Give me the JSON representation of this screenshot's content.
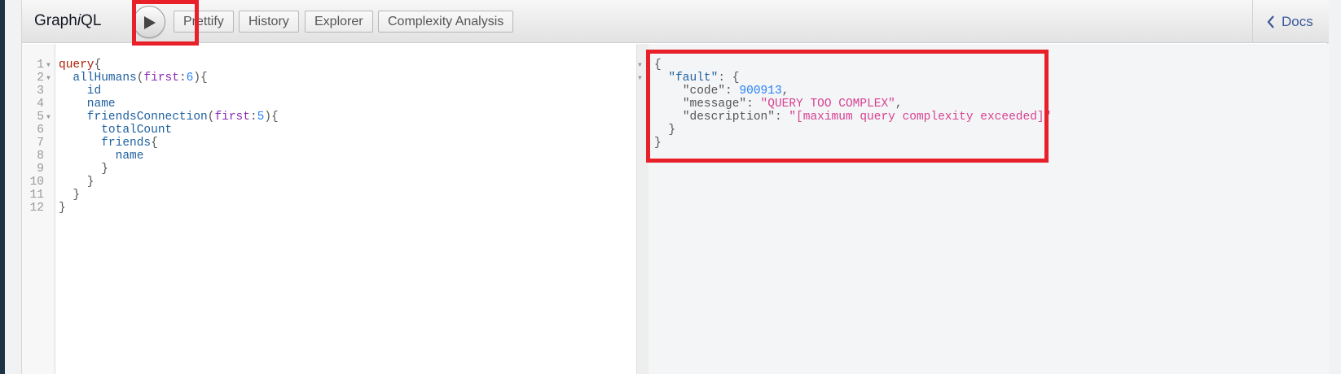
{
  "app": {
    "title_prefix": "Graph",
    "title_italic": "i",
    "title_suffix": "QL"
  },
  "toolbar": {
    "run_label": "Execute query",
    "buttons": [
      "Prettify",
      "History",
      "Explorer",
      "Complexity Analysis"
    ],
    "docs_label": "Docs"
  },
  "query_editor": {
    "line_numbers": [
      "1",
      "2",
      "3",
      "4",
      "5",
      "6",
      "7",
      "8",
      "9",
      "10",
      "11",
      "12"
    ],
    "lines": [
      [
        [
          "kw",
          "query"
        ],
        [
          "pun",
          "{"
        ]
      ],
      [
        [
          "def",
          "  allHumans"
        ],
        [
          "pun",
          "("
        ],
        [
          "attr",
          "first"
        ],
        [
          "pun",
          ":"
        ],
        [
          "num",
          "6"
        ],
        [
          "pun",
          "){"
        ]
      ],
      [
        [
          "def",
          "    id"
        ]
      ],
      [
        [
          "def",
          "    name"
        ]
      ],
      [
        [
          "def",
          "    friendsConnection"
        ],
        [
          "pun",
          "("
        ],
        [
          "attr",
          "first"
        ],
        [
          "pun",
          ":"
        ],
        [
          "num",
          "5"
        ],
        [
          "pun",
          "){"
        ]
      ],
      [
        [
          "def",
          "      totalCount"
        ]
      ],
      [
        [
          "def",
          "      friends"
        ],
        [
          "pun",
          "{"
        ]
      ],
      [
        [
          "def",
          "        name"
        ]
      ],
      [
        [
          "pun",
          "      }"
        ]
      ],
      [
        [
          "pun",
          "    }"
        ]
      ],
      [
        [
          "pun",
          "  }"
        ]
      ],
      [
        [
          "pun",
          "}"
        ]
      ]
    ]
  },
  "response": {
    "lines": [
      [
        [
          "pun",
          "{"
        ]
      ],
      [
        [
          "pun",
          "  "
        ],
        [
          "prop",
          "\"fault\""
        ],
        [
          "pun",
          ": {"
        ]
      ],
      [
        [
          "pun",
          "    "
        ],
        [
          "pun",
          "\"code\""
        ],
        [
          "pun",
          ": "
        ],
        [
          "num",
          "900913"
        ],
        [
          "pun",
          ","
        ]
      ],
      [
        [
          "pun",
          "    "
        ],
        [
          "pun",
          "\"message\""
        ],
        [
          "pun",
          ": "
        ],
        [
          "str",
          "\"QUERY TOO COMPLEX\""
        ],
        [
          "pun",
          ","
        ]
      ],
      [
        [
          "pun",
          "    "
        ],
        [
          "pun",
          "\"description\""
        ],
        [
          "pun",
          ": "
        ],
        [
          "str",
          "\"[maximum query complexity exceeded]\""
        ]
      ],
      [
        [
          "pun",
          "  }"
        ]
      ],
      [
        [
          "pun",
          "}"
        ]
      ]
    ]
  },
  "colors": {
    "highlight": "#e8202a",
    "keyword": "#b11a04",
    "definition": "#1f61a0",
    "attribute": "#8b2bb9",
    "number": "#2882f9",
    "string": "#d64292"
  },
  "icons": [
    "play-icon",
    "chevron-left-icon",
    "fold-arrow-icon"
  ]
}
